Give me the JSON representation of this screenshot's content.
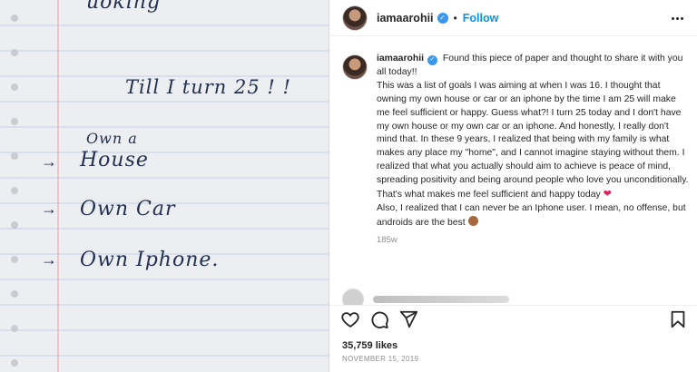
{
  "photo": {
    "text_top": "uoking",
    "title": "Till I turn 25 ! !",
    "prefix": "Own a",
    "arrow": "→",
    "items": [
      "House",
      "Own Car",
      "Own Iphone."
    ]
  },
  "header": {
    "username": "iamaarohii",
    "verified_mark": "✓",
    "separator": "•",
    "follow_label": "Follow",
    "more_icon": "more-options-icon"
  },
  "caption": {
    "username": "iamaarohii",
    "text": "Found this piece of paper and thought to share it with you all today!!\nThis was a list of goals I was aiming at when I was 16. I thought that owning my own house or car or an iphone by the time I am 25 will make me feel sufficient or happy. Guess what?! I turn 25 today and I don't have my own house or my own car or an iphone. And honestly, I really don't mind that. In these 9 years, I realized that being with my family is what makes any place my \"home\", and I cannot imagine staying without them. I realized that what you actually should aim to achieve is peace of mind, spreading positivity and being around people who love you unconditionally. That's what makes me feel sufficient and happy today",
    "heart": "❤",
    "text2": "Also, I realized that I can never be an Iphone user. I mean, no offense, but androids are the best",
    "age": "185w"
  },
  "stats": {
    "likes": "35,759 likes",
    "date": "NOVEMBER 15, 2019"
  },
  "colors": {
    "accent": "#0095f6",
    "verified": "#3897f0",
    "heart": "#e0245e",
    "ink": "#23304f"
  }
}
